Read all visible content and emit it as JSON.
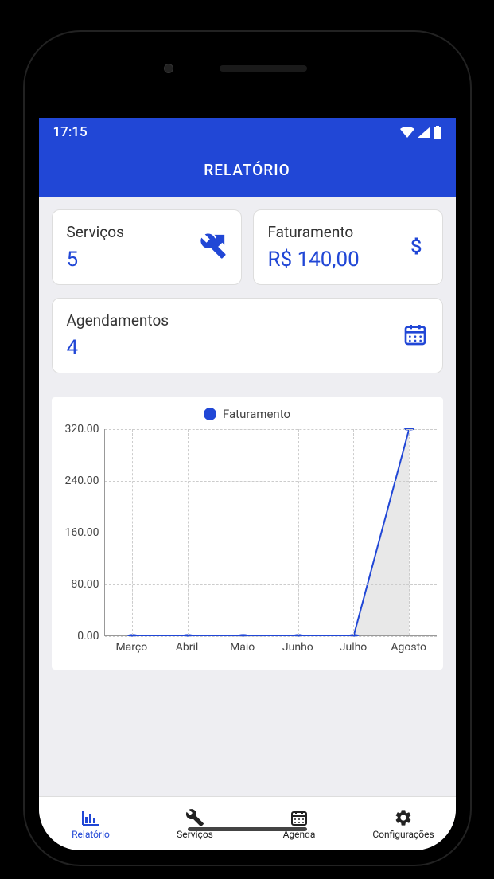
{
  "status": {
    "time": "17:15"
  },
  "header": {
    "title": "RELATÓRIO"
  },
  "cards": {
    "services": {
      "title": "Serviços",
      "value": "5"
    },
    "revenue": {
      "title": "Faturamento",
      "value": "R$ 140,00"
    },
    "appointments": {
      "title": "Agendamentos",
      "value": "4"
    }
  },
  "chart": {
    "legend": "Faturamento"
  },
  "chart_data": {
    "type": "line",
    "title": "",
    "legend": "Faturamento",
    "categories": [
      "Março",
      "Abril",
      "Maio",
      "Junho",
      "Julho",
      "Agosto"
    ],
    "values": [
      0,
      0,
      0,
      0,
      0,
      320
    ],
    "ylabel": "",
    "xlabel": "",
    "ylim": [
      0,
      320
    ],
    "y_ticks": [
      "0.00",
      "80.00",
      "160.00",
      "240.00",
      "320.00"
    ]
  },
  "nav": {
    "items": [
      {
        "label": "Relatório",
        "active": true
      },
      {
        "label": "Serviços",
        "active": false
      },
      {
        "label": "Agenda",
        "active": false
      },
      {
        "label": "Configurações",
        "active": false
      }
    ]
  }
}
